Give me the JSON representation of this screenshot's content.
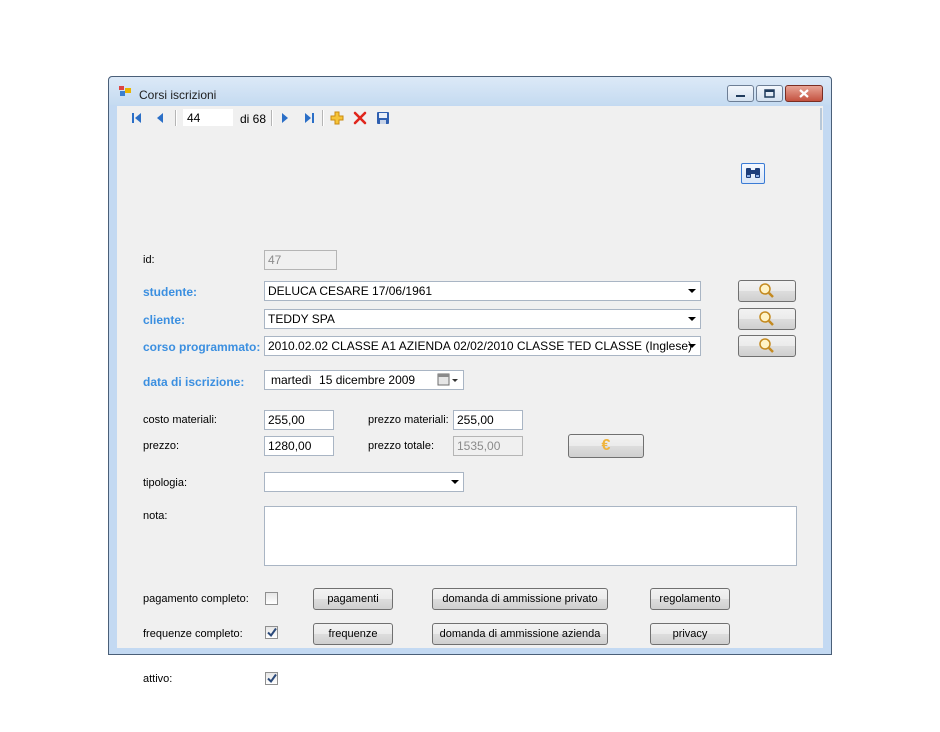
{
  "window": {
    "title": "Corsi iscrizioni"
  },
  "toolbar": {
    "position": "44",
    "count": "di 68"
  },
  "fields": {
    "id_label": "id:",
    "id_value": "47",
    "studente_label": "studente:",
    "studente_value": "DELUCA CESARE 17/06/1961",
    "cliente_label": "cliente:",
    "cliente_value": "TEDDY SPA",
    "corso_label": "corso programmato:",
    "corso_value": "2010.02.02 CLASSE A1 AZIENDA 02/02/2010 CLASSE TED CLASSE (Inglese)",
    "data_label": "data di iscrizione:",
    "data_day": "martedì",
    "data_date": "15 dicembre  2009",
    "costo_materiali_label": "costo materiali:",
    "costo_materiali_value": "255,00",
    "prezzo_materiali_label": "prezzo materiali:",
    "prezzo_materiali_value": "255,00",
    "prezzo_label": "prezzo:",
    "prezzo_value": "1280,00",
    "prezzo_totale_label": "prezzo totale:",
    "prezzo_totale_value": "1535,00",
    "tipologia_label": "tipologia:",
    "tipologia_value": "",
    "nota_label": "nota:",
    "nota_value": "",
    "pagamento_label": "pagamento completo:",
    "frequenze_label": "frequenze completo:",
    "attivo_label": "attivo:"
  },
  "checks": {
    "pagamento_completo": false,
    "frequenze_completo": true,
    "attivo": true
  },
  "buttons": {
    "euro": "€",
    "pagamenti": "pagamenti",
    "domanda_privato": "domanda di ammissione privato",
    "regolamento": "regolamento",
    "frequenze": "frequenze",
    "domanda_azienda": "domanda di ammissione azienda",
    "privacy": "privacy"
  },
  "colors": {
    "label_blue": "#3b8fe0",
    "euro": "#f0b43c"
  }
}
